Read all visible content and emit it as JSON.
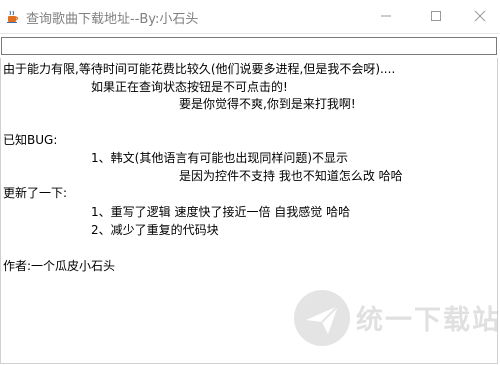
{
  "window": {
    "title": "查询歌曲下载地址--By:小石头",
    "icons": {
      "app": "java-cup-icon",
      "minimize": "minimize-icon",
      "maximize": "maximize-icon",
      "close": "close-icon"
    }
  },
  "url_input": {
    "value": ""
  },
  "content": {
    "lines": [
      "由于能力有限,等待时间可能花费比较久(他们说要多进程,但是我不会呀)....",
      "如果正在查询状态按钮是不可点击的!",
      "要是你觉得不爽,你到是来打我啊!",
      "已知BUG:",
      "1、韩文(其他语言有可能也出现同样问题)不显示",
      "是因为控件不支持 我也不知道怎么改 哈哈",
      "更新了一下:",
      "1、重写了逻辑 速度快了接近一倍 自我感觉 哈哈",
      "2、减少了重复的代码块",
      "作者:一个瓜皮小石头"
    ]
  },
  "watermark": {
    "title": "统一下载站",
    "subtitle": "",
    "icon": "paper-plane-logo-icon"
  }
}
